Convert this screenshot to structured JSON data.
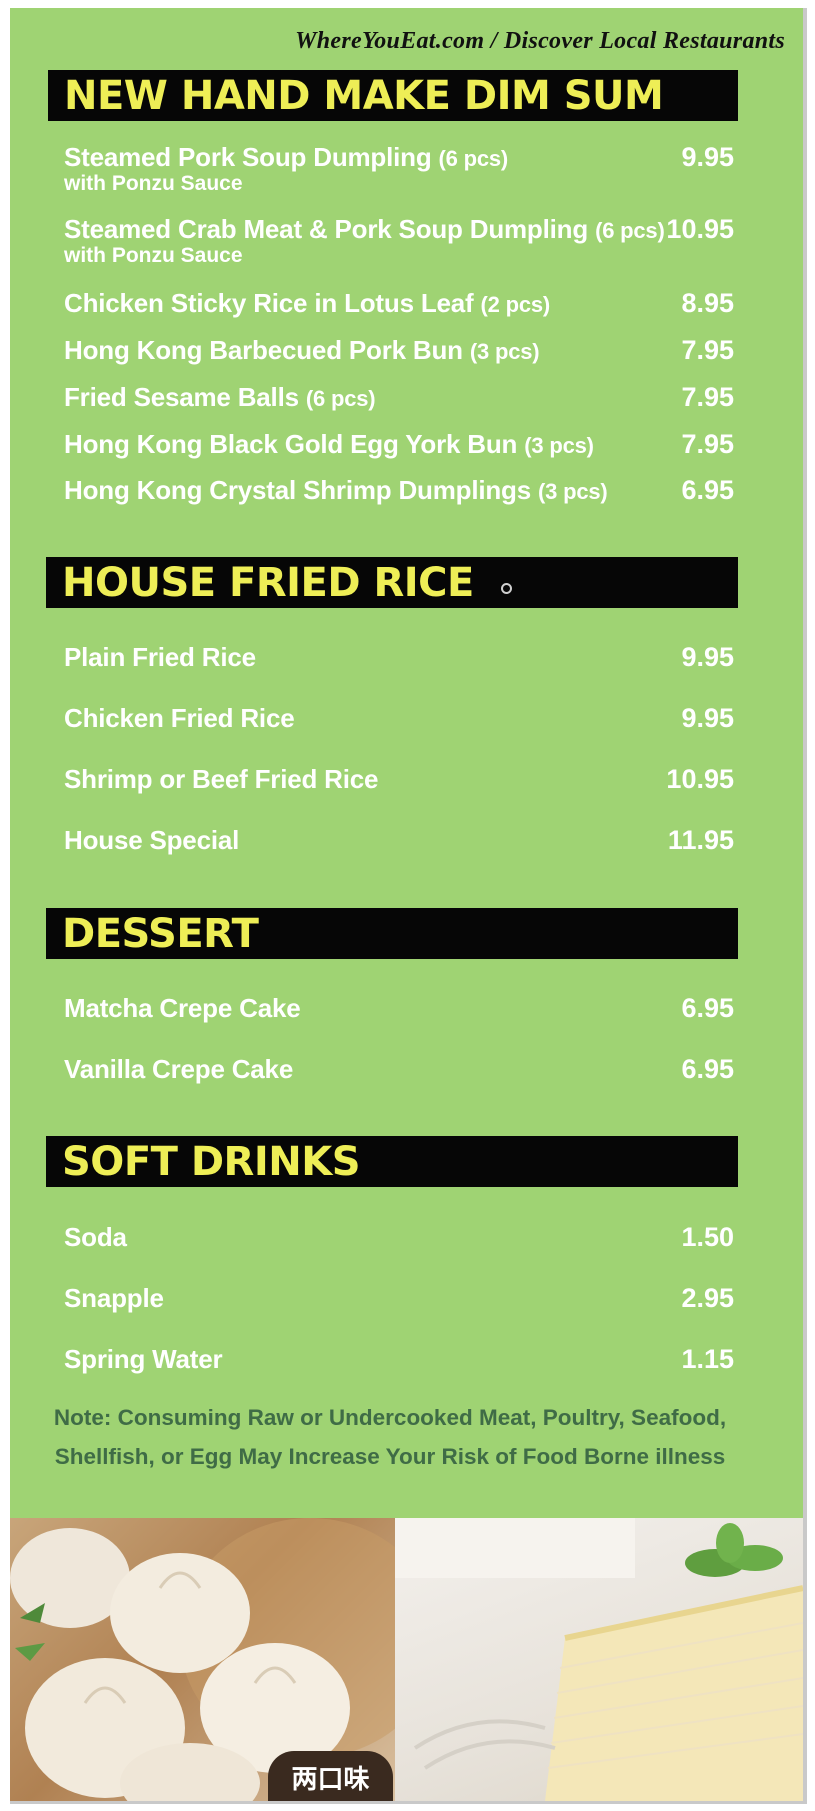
{
  "watermark": "WhereYouEat.com / Discover Local Restaurants",
  "sections": [
    {
      "title": "NEW HAND MAKE DIM SUM",
      "items": [
        {
          "name": "Steamed Pork Soup Dumpling",
          "qty": "(6 pcs)",
          "sub": "with Ponzu Sauce",
          "price": "9.95"
        },
        {
          "name": "Steamed Crab Meat & Pork Soup Dumpling",
          "qty": "(6 pcs)",
          "sub": "with Ponzu Sauce",
          "price": "10.95"
        },
        {
          "name": "Chicken Sticky Rice in Lotus Leaf",
          "qty": "(2 pcs)",
          "price": "8.95"
        },
        {
          "name": "Hong Kong Barbecued Pork Bun",
          "qty": "(3 pcs)",
          "price": "7.95"
        },
        {
          "name": "Fried Sesame Balls",
          "qty": "(6 pcs)",
          "price": "7.95"
        },
        {
          "name": "Hong Kong Black Gold Egg York Bun",
          "qty": "(3 pcs)",
          "price": "7.95"
        },
        {
          "name": "Hong Kong Crystal Shrimp Dumplings",
          "qty": "(3 pcs)",
          "price": "6.95"
        }
      ]
    },
    {
      "title": "HOUSE FRIED RICE",
      "items": [
        {
          "name": "Plain Fried Rice",
          "price": "9.95"
        },
        {
          "name": "Chicken Fried Rice",
          "price": "9.95"
        },
        {
          "name": "Shrimp or Beef Fried Rice",
          "price": "10.95"
        },
        {
          "name": "House Special",
          "price": "11.95"
        }
      ]
    },
    {
      "title": "DESSERT",
      "items": [
        {
          "name": "Matcha Crepe Cake",
          "price": "6.95"
        },
        {
          "name": "Vanilla Crepe Cake",
          "price": "6.95"
        }
      ]
    },
    {
      "title": "SOFT DRINKS",
      "items": [
        {
          "name": "Soda",
          "price": "1.50"
        },
        {
          "name": "Snapple",
          "price": "2.95"
        },
        {
          "name": "Spring Water",
          "price": "1.15"
        }
      ]
    }
  ],
  "note": "Note: Consuming Raw or Undercooked Meat, Poultry, Seafood, Shellfish, or Egg May Increase Your Risk of Food Borne illness",
  "photos": {
    "left_label": "两口味",
    "left_subject": "soup dumplings",
    "right_subject": "crepe cake"
  },
  "colors": {
    "background": "#9fd373",
    "header_bar": "#060606",
    "header_text": "#eeee56",
    "item_text": "#ffffff",
    "note_text": "#3f6c46"
  }
}
